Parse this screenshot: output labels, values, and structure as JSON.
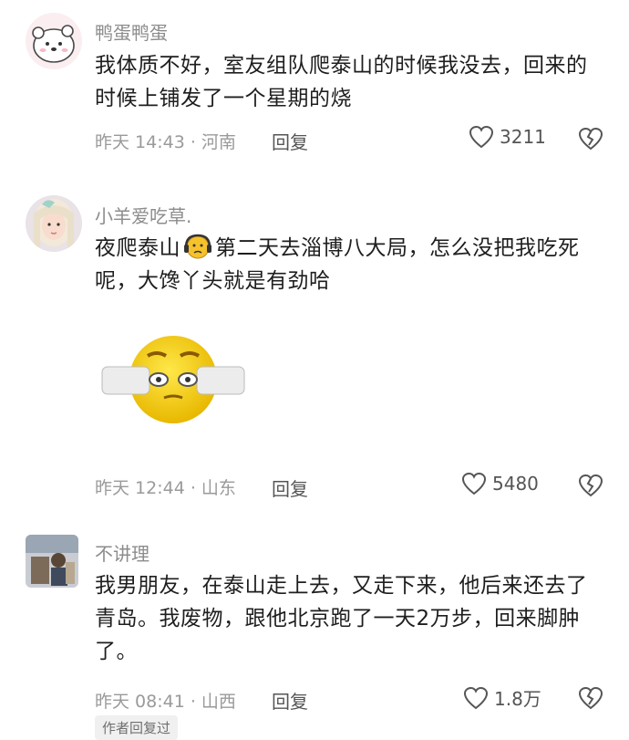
{
  "comments": [
    {
      "username": "鸭蛋鸭蛋",
      "content": "我体质不好，室友组队爬泰山的时候我没去，回来的时候上铺发了一个星期的烧",
      "meta": "昨天 14:43 · 河南",
      "reply_label": "回复",
      "likes": "3211"
    },
    {
      "username": "小羊爱吃草.",
      "content_before_emoji": "夜爬泰山",
      "content_after_emoji": "第二天去淄博八大局，怎么没把我吃死呢，大馋丫头就是有劲哈",
      "meta": "昨天 12:44 · 山东",
      "reply_label": "回复",
      "likes": "5480"
    },
    {
      "username": "不讲理",
      "content": "我男朋友，在泰山走上去，又走下来，他后来还去了青岛。我废物，跟他北京跑了一天2万步，回来脚肿了。",
      "meta": "昨天 08:41 · 山西",
      "reply_label": "回复",
      "likes": "1.8万",
      "author_badge": "作者回复过"
    }
  ],
  "colors": {
    "username": "#8c8c8c",
    "content": "#1e1e1e",
    "meta": "#9a9a9a",
    "badge_bg": "#f0f0f0"
  }
}
